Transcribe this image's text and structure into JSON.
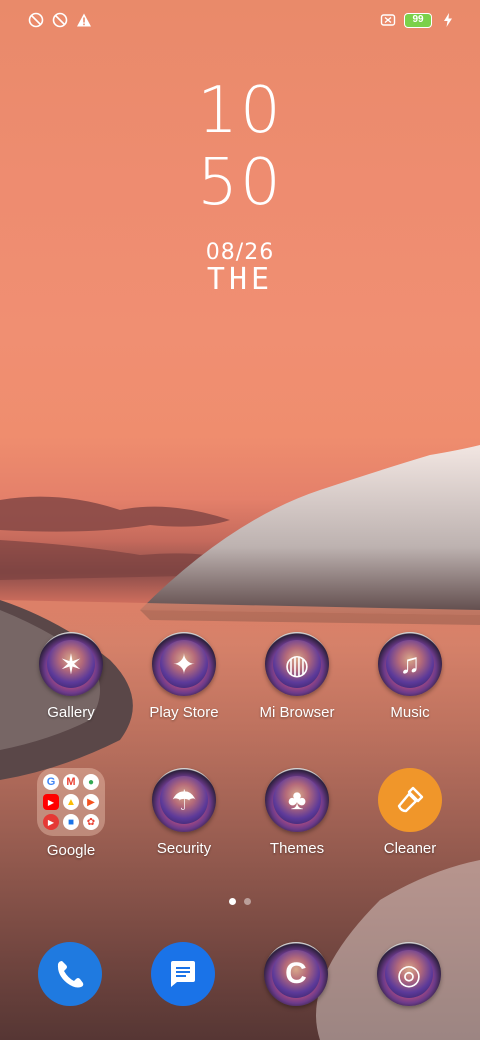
{
  "status": {
    "left_icons": [
      "vpn-off-icon",
      "data-saver-icon",
      "alert-icon"
    ],
    "battery_level": "99"
  },
  "clock": {
    "hour": "10",
    "minute": "50",
    "date": "08/26",
    "day": "THE"
  },
  "apps_row1": [
    {
      "label": "Gallery",
      "icon": "gallery-icon"
    },
    {
      "label": "Play Store",
      "icon": "play-store-icon"
    },
    {
      "label": "Mi Browser",
      "icon": "browser-icon"
    },
    {
      "label": "Music",
      "icon": "music-icon"
    }
  ],
  "apps_row2": [
    {
      "label": "Google",
      "icon": "google-folder-icon"
    },
    {
      "label": "Security",
      "icon": "security-icon"
    },
    {
      "label": "Themes",
      "icon": "themes-icon"
    },
    {
      "label": "Cleaner",
      "icon": "cleaner-icon"
    }
  ],
  "dock": [
    {
      "icon": "phone-icon"
    },
    {
      "icon": "messages-icon"
    },
    {
      "icon": "chrome-icon"
    },
    {
      "icon": "camera-icon"
    }
  ],
  "page_indicator": {
    "pages": 2,
    "active": 1
  },
  "colors": {
    "sky": "#ef8d6e",
    "battery_fill": "#7bd14a",
    "cleaner": "#f0962a",
    "phone": "#1f7ae0"
  }
}
